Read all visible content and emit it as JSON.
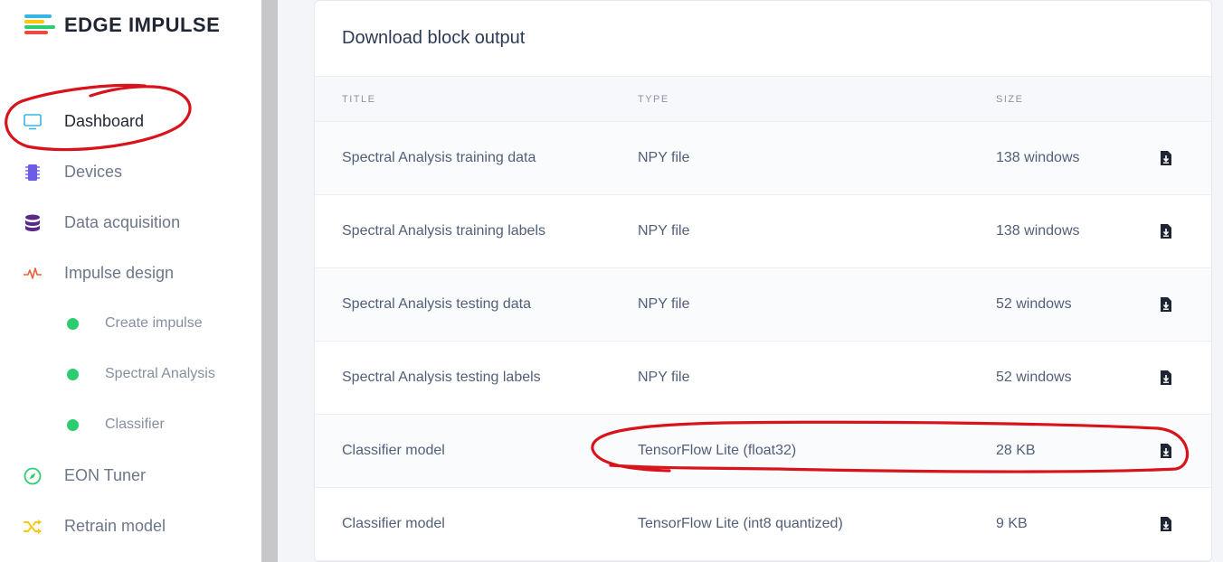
{
  "brand": {
    "name": "EDGE IMPULSE",
    "colors": [
      "#38b6e8",
      "#f6c90e",
      "#2ecc71",
      "#e74c3c"
    ]
  },
  "sidebar": {
    "items": [
      {
        "label": "Dashboard",
        "icon": "monitor-icon",
        "color": "#38b6e8",
        "active": true
      },
      {
        "label": "Devices",
        "icon": "chip-icon",
        "color": "#6c5ce7"
      },
      {
        "label": "Data acquisition",
        "icon": "database-icon",
        "color": "#5b2a86"
      },
      {
        "label": "Impulse design",
        "icon": "pulse-icon",
        "color": "#e8623c"
      },
      {
        "label": "Create impulse",
        "sub": true
      },
      {
        "label": "Spectral Analysis",
        "sub": true
      },
      {
        "label": "Classifier",
        "sub": true
      },
      {
        "label": "EON Tuner",
        "icon": "compass-icon",
        "color": "#2ecc71"
      },
      {
        "label": "Retrain model",
        "icon": "shuffle-icon",
        "color": "#f6c90e"
      }
    ]
  },
  "card": {
    "title": "Download block output",
    "columns": {
      "title": "TITLE",
      "type": "TYPE",
      "size": "SIZE"
    },
    "rows": [
      {
        "title": "Spectral Analysis training data",
        "type": "NPY file",
        "size": "138 windows"
      },
      {
        "title": "Spectral Analysis training labels",
        "type": "NPY file",
        "size": "138 windows"
      },
      {
        "title": "Spectral Analysis testing data",
        "type": "NPY file",
        "size": "52 windows"
      },
      {
        "title": "Spectral Analysis testing labels",
        "type": "NPY file",
        "size": "52 windows"
      },
      {
        "title": "Classifier model",
        "type": "TensorFlow Lite (float32)",
        "size": "28 KB"
      },
      {
        "title": "Classifier model",
        "type": "TensorFlow Lite (int8 quantized)",
        "size": "9 KB"
      }
    ]
  },
  "annotation_color": "#d9131b"
}
